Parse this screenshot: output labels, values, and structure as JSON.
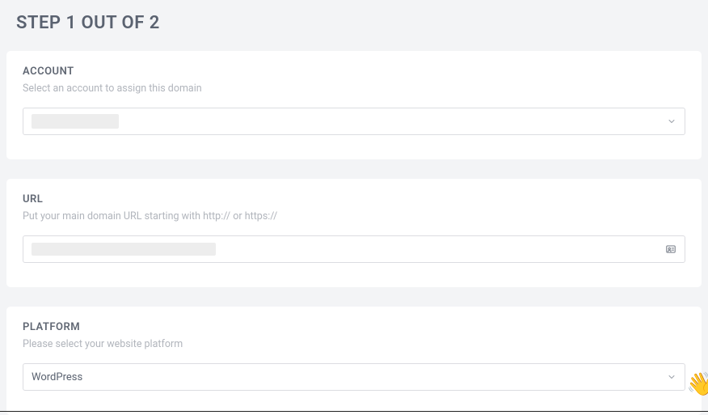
{
  "header": {
    "step_title": "STEP 1 OUT OF 2"
  },
  "account": {
    "title": "ACCOUNT",
    "description": "Select an account to assign this domain",
    "selected": ""
  },
  "url": {
    "title": "URL",
    "description": "Put your main domain URL starting with http:// or https://",
    "value": "",
    "placeholder": ""
  },
  "platform": {
    "title": "PLATFORM",
    "description": "Please select your website platform",
    "selected": "WordPress"
  },
  "helper": {
    "emoji": "👋"
  }
}
